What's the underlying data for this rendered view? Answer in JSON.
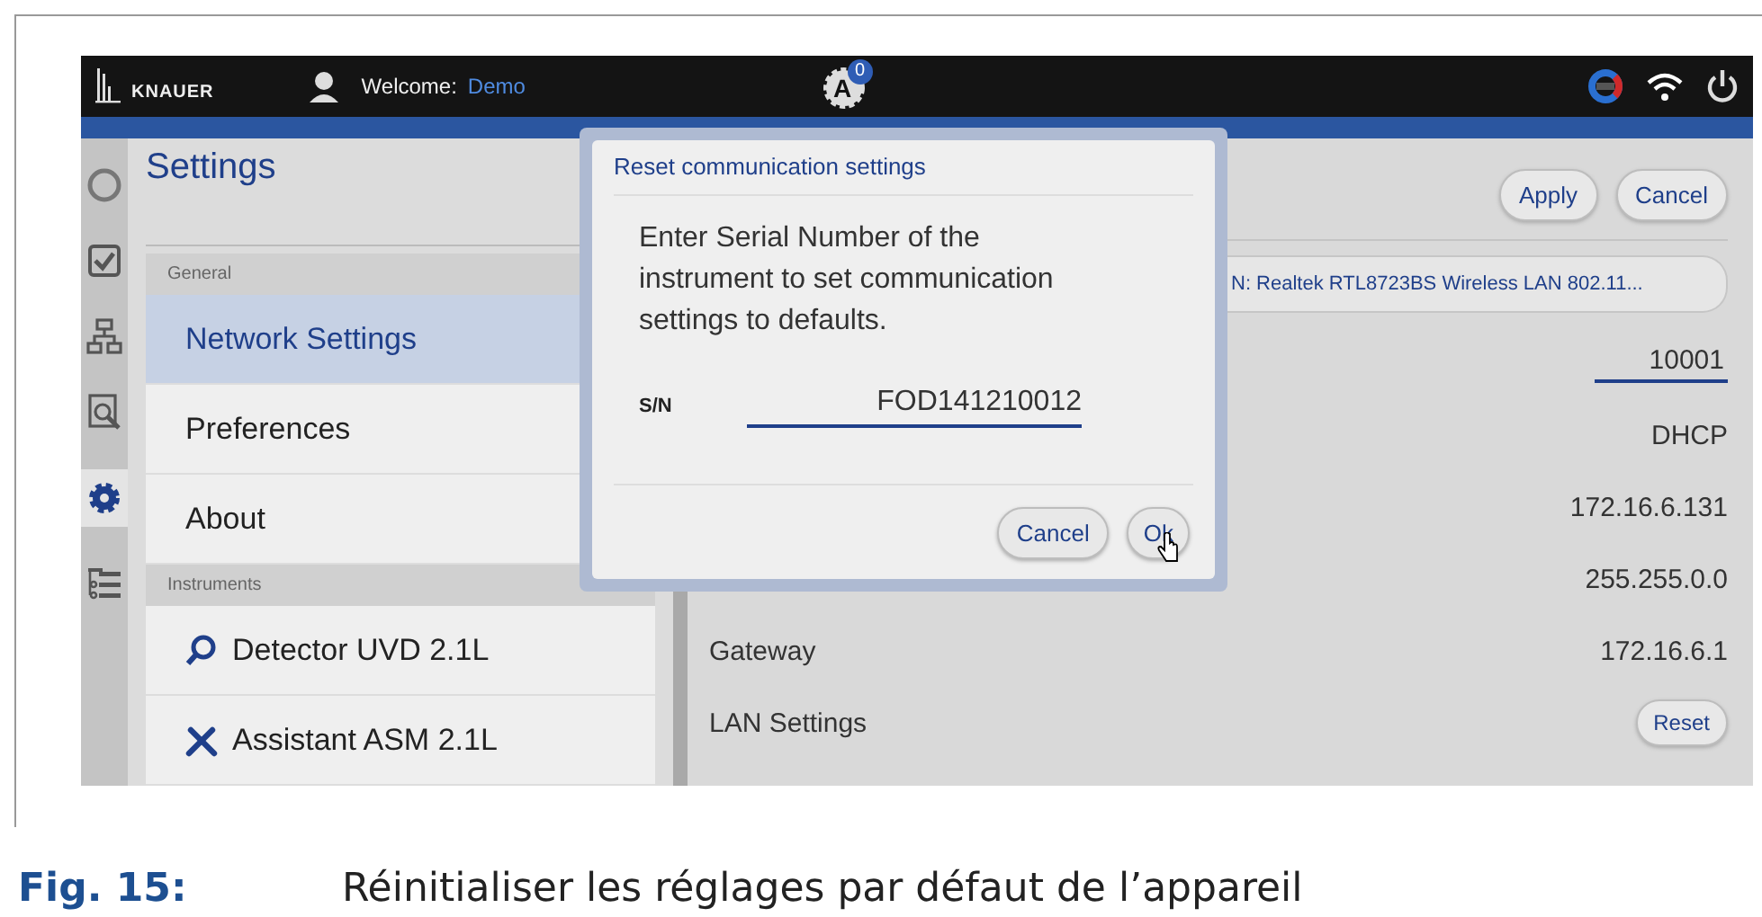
{
  "topbar": {
    "logo": "KNAUER",
    "welcome_label": "Welcome:",
    "user": "Demo",
    "gear_letter": "A",
    "badge": "0"
  },
  "rail": [
    {
      "kind": "circle",
      "selected": false
    },
    {
      "kind": "check",
      "selected": false
    },
    {
      "kind": "flow",
      "selected": false
    },
    {
      "kind": "search",
      "selected": false
    },
    {
      "kind": "gear",
      "selected": true
    },
    {
      "kind": "list",
      "selected": false
    }
  ],
  "settings": {
    "title": "Settings",
    "sections": [
      {
        "header": "General",
        "items": [
          {
            "label": "Network Settings",
            "selected": true
          },
          {
            "label": "Preferences",
            "selected": false
          },
          {
            "label": "About",
            "selected": false
          }
        ]
      },
      {
        "header": "Instruments",
        "items": [
          {
            "label": "Detector UVD 2.1L",
            "kind": "detector",
            "selected": false
          },
          {
            "label": "Assistant ASM 2.1L",
            "kind": "assistant",
            "selected": false
          }
        ]
      }
    ]
  },
  "network": {
    "buttons": [
      "Apply",
      "Cancel"
    ],
    "adapter": "N: Realtek RTL8723BS Wireless LAN 802.11...",
    "rows": [
      {
        "kind": "field",
        "value": "10001"
      },
      {
        "kind": "text",
        "value": "DHCP"
      },
      {
        "kind": "text",
        "value": "172.16.6.131"
      },
      {
        "kind": "text",
        "value": "255.255.0.0"
      },
      {
        "kind": "text",
        "label": "Gateway",
        "value": "172.16.6.1"
      },
      {
        "kind": "button",
        "label": "LAN Settings",
        "value": "Reset"
      }
    ]
  },
  "dialog": {
    "title": "Reset communication settings",
    "message": "Enter Serial Number of the instrument to set communication settings to defaults.",
    "field_label": "S/N",
    "field_value": "FOD141210012",
    "buttons": [
      "Cancel",
      "Ok"
    ]
  },
  "caption": {
    "number": "Fig. 15:",
    "text": "Réinitialiser les réglages par défaut de l’appareil"
  }
}
